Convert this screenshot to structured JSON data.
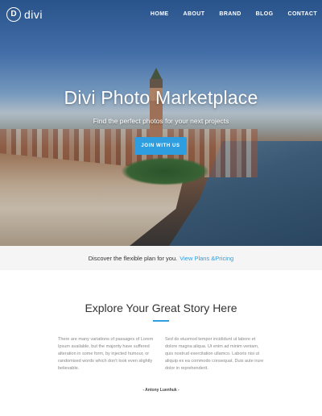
{
  "brand": {
    "logo_letter": "D",
    "name": "divi"
  },
  "nav": {
    "items": [
      {
        "label": "HOME"
      },
      {
        "label": "ABOUT"
      },
      {
        "label": "BRAND"
      },
      {
        "label": "BLOG"
      },
      {
        "label": "CONTACT"
      }
    ]
  },
  "hero": {
    "title": "Divi Photo Marketplace",
    "subtitle": "Find the perfect photos for your next projects",
    "button_label": "JOIN WITH US"
  },
  "plan_bar": {
    "text": "Discover the flexible plan for you.",
    "link_label": "View Plans &Pricing"
  },
  "story": {
    "title": "Explore Your Great Story Here",
    "left_paragraph": "There are many variations of passages of Lorem Ipsum available, but the majority have suffered alteration in some form, by injected humour, or randomised words which don't look even slightly believable.",
    "right_paragraph": "Sed do eiusmod tempor incididunt ut labore et dolore magna aliqua. Ut enim ad minim veniam, quis nostrud exercitation ullamco. Laboris nisi ut aliquip ex ea commodo consequat. Duis aute irure dolor in reprehenderit.",
    "author": "- Antony Luenhuk -"
  },
  "colors": {
    "accent": "#2f9ee0",
    "plan_bar_bg": "#f5f5f5"
  }
}
